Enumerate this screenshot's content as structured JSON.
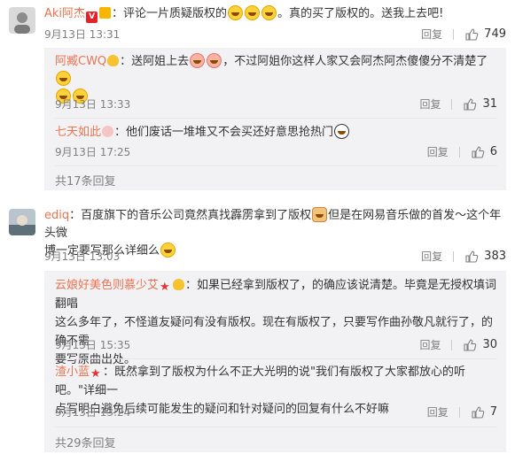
{
  "comments": [
    {
      "user": "Aki阿杰",
      "text_a": "：评论一片质疑版权的",
      "text_b": "。真的买了版权的。送我上去吧!",
      "time": "9月13日 13:31",
      "reply": "回复",
      "likes": "749",
      "replies": [
        {
          "user": "阿臧CWQ",
          "text_a": "：送阿姐上去",
          "text_b": "，不过阿姐你这样人家又会阿杰阿杰傻傻分不清楚了",
          "time": "9月13日 13:33",
          "reply": "回复",
          "likes": "31"
        },
        {
          "user": "七天如此",
          "text_a": "：他们废话一堆堆又不会买还好意思抢热门",
          "time": "9月13日 17:25",
          "reply": "回复",
          "likes": "6"
        }
      ],
      "more": "共17条回复"
    },
    {
      "user": "ediq",
      "text_a": "：百度旗下的音乐公司竟然真找霹雳拿到了版权",
      "text_b": "但是在网易音乐做的首发～这个年头微",
      "text_c": "博一定要写那么详细么",
      "time": "9月13日 13:03",
      "reply": "回复",
      "likes": "383",
      "replies": [
        {
          "user": "云娘好美色则慕少艾",
          "line1": "：如果已经拿到版权了，的确应该说清楚。毕竟是无授权填词翻唱",
          "line2": "这么多年了，不怪道友疑问有没有版权。现在有版权了，只要写作曲孙敬凡就行了，的确不需",
          "line3": "要写原曲出处。",
          "time": "9月13日 15:35",
          "reply": "回复",
          "likes": "30"
        },
        {
          "user": "渣小蓝",
          "line1": "：既然拿到了版权为什么不正大光明的说\"我们有版权了大家都放心的听吧。\"详细一",
          "line2": "点写明白避免后续可能发生的疑问和针对疑问的回复有什么不好嘛",
          "time": "9月13日 13:24",
          "reply": "回复",
          "likes": "7"
        }
      ],
      "more": "共29条回复"
    }
  ],
  "colors": {
    "username": "#eb7350",
    "meta": "#808080",
    "reply_bg": "#f2f2f5"
  },
  "icons": [
    "like-icon",
    "verified-badge-icon",
    "crown-badge-icon",
    "star-badge-icon",
    "bulb-badge-icon",
    "laugh-cry-emoji-icon",
    "pig-emoji-icon",
    "panda-emoji-icon",
    "thumbs-up-emoji-icon"
  ]
}
